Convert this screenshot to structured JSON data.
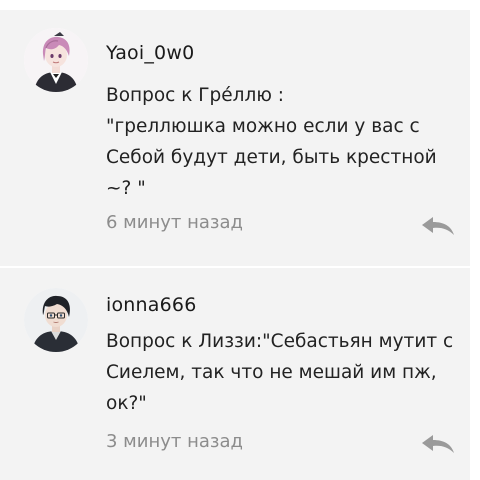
{
  "comments": [
    {
      "username": "Yaoi_0w0",
      "text": "Вопрос к Грéллю :\n\"греллюшка можно если у вас с Себой будут дети, быть крестной ~? \"",
      "time": "6 минут назад",
      "avatar_icon": "anime-avatar-pink-hair-icon"
    },
    {
      "username": "ionna666",
      "text": "Вопрос к Лиззи:\"Себастьян мутит с Сиелем, так что не мешай им пж, ок?\"",
      "time": "3 минут назад",
      "avatar_icon": "anime-avatar-dark-hair-glasses-icon"
    }
  ],
  "colors": {
    "background": "#f3f3f3",
    "username": "#1a1a1a",
    "body_text": "#222222",
    "timestamp": "#8c8c8c",
    "reply_icon": "#9a9a9a"
  },
  "icons": {
    "reply": "reply-arrow-icon"
  }
}
